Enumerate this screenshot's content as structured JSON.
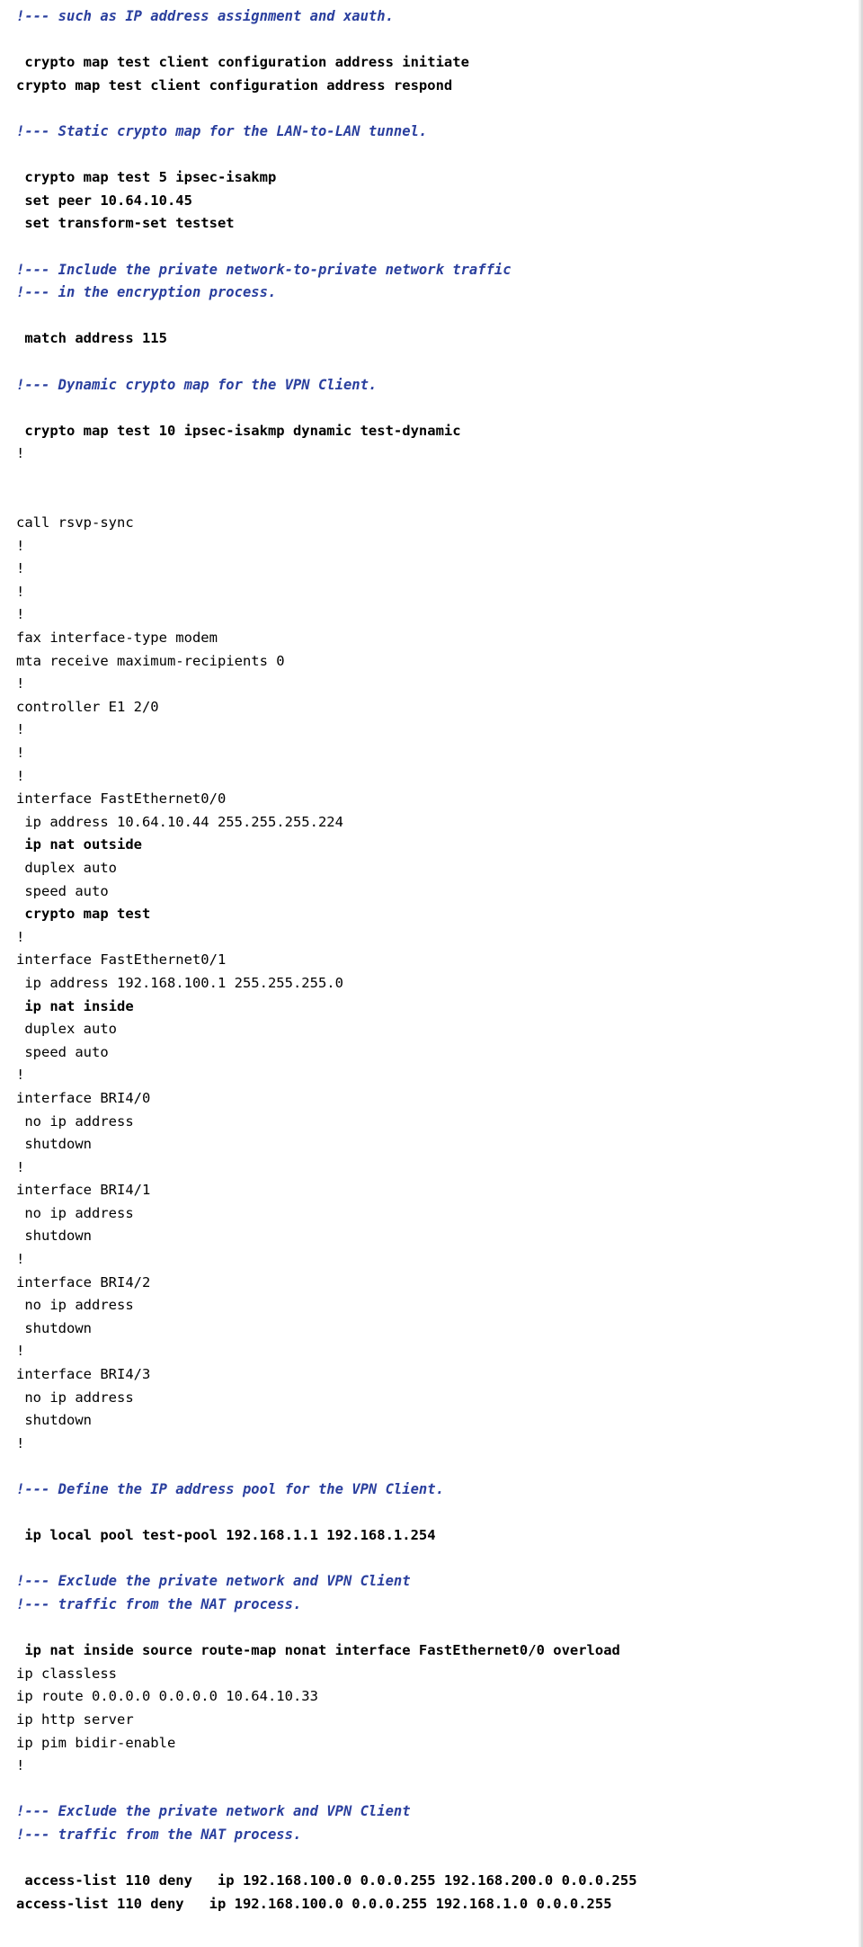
{
  "document": {
    "type": "cisco-router-configuration-listing",
    "lines": [
      {
        "text": "!--- such as IP address assignment and xauth.",
        "style": "comment"
      },
      {
        "text": "",
        "style": "blank"
      },
      {
        "text": " crypto map test client configuration address initiate",
        "style": "bold"
      },
      {
        "text": "crypto map test client configuration address respond",
        "style": "bold"
      },
      {
        "text": "",
        "style": "blank"
      },
      {
        "text": "!--- Static crypto map for the LAN-to-LAN tunnel.",
        "style": "comment"
      },
      {
        "text": "",
        "style": "blank"
      },
      {
        "text": " crypto map test 5 ipsec-isakmp",
        "style": "bold"
      },
      {
        "text": " set peer 10.64.10.45",
        "style": "bold"
      },
      {
        "text": " set transform-set testset",
        "style": "bold"
      },
      {
        "text": "",
        "style": "blank"
      },
      {
        "text": "!--- Include the private network-to-private network traffic",
        "style": "comment"
      },
      {
        "text": "!--- in the encryption process.",
        "style": "comment"
      },
      {
        "text": "",
        "style": "blank"
      },
      {
        "text": " match address 115",
        "style": "bold"
      },
      {
        "text": "",
        "style": "blank"
      },
      {
        "text": "!--- Dynamic crypto map for the VPN Client.",
        "style": "comment"
      },
      {
        "text": "",
        "style": "blank"
      },
      {
        "text": " crypto map test 10 ipsec-isakmp dynamic test-dynamic",
        "style": "bold"
      },
      {
        "text": "!",
        "style": "plain"
      },
      {
        "text": "",
        "style": "blank"
      },
      {
        "text": "",
        "style": "blank"
      },
      {
        "text": "call rsvp-sync",
        "style": "plain"
      },
      {
        "text": "!",
        "style": "plain"
      },
      {
        "text": "!",
        "style": "plain"
      },
      {
        "text": "!",
        "style": "plain"
      },
      {
        "text": "!",
        "style": "plain"
      },
      {
        "text": "fax interface-type modem",
        "style": "plain"
      },
      {
        "text": "mta receive maximum-recipients 0",
        "style": "plain"
      },
      {
        "text": "!",
        "style": "plain"
      },
      {
        "text": "controller E1 2/0",
        "style": "plain"
      },
      {
        "text": "!",
        "style": "plain"
      },
      {
        "text": "!",
        "style": "plain"
      },
      {
        "text": "!",
        "style": "plain"
      },
      {
        "text": "interface FastEthernet0/0",
        "style": "plain"
      },
      {
        "text": " ip address 10.64.10.44 255.255.255.224",
        "style": "plain"
      },
      {
        "text": " ip nat outside",
        "style": "bold"
      },
      {
        "text": " duplex auto",
        "style": "plain"
      },
      {
        "text": " speed auto",
        "style": "plain"
      },
      {
        "text": " crypto map test",
        "style": "bold"
      },
      {
        "text": "!",
        "style": "plain"
      },
      {
        "text": "interface FastEthernet0/1",
        "style": "plain"
      },
      {
        "text": " ip address 192.168.100.1 255.255.255.0",
        "style": "plain"
      },
      {
        "text": " ip nat inside",
        "style": "bold"
      },
      {
        "text": " duplex auto",
        "style": "plain"
      },
      {
        "text": " speed auto",
        "style": "plain"
      },
      {
        "text": "!",
        "style": "plain"
      },
      {
        "text": "interface BRI4/0",
        "style": "plain"
      },
      {
        "text": " no ip address",
        "style": "plain"
      },
      {
        "text": " shutdown",
        "style": "plain"
      },
      {
        "text": "!",
        "style": "plain"
      },
      {
        "text": "interface BRI4/1",
        "style": "plain"
      },
      {
        "text": " no ip address",
        "style": "plain"
      },
      {
        "text": " shutdown",
        "style": "plain"
      },
      {
        "text": "!",
        "style": "plain"
      },
      {
        "text": "interface BRI4/2",
        "style": "plain"
      },
      {
        "text": " no ip address",
        "style": "plain"
      },
      {
        "text": " shutdown",
        "style": "plain"
      },
      {
        "text": "!",
        "style": "plain"
      },
      {
        "text": "interface BRI4/3",
        "style": "plain"
      },
      {
        "text": " no ip address",
        "style": "plain"
      },
      {
        "text": " shutdown",
        "style": "plain"
      },
      {
        "text": "!",
        "style": "plain"
      },
      {
        "text": "",
        "style": "blank"
      },
      {
        "text": "!--- Define the IP address pool for the VPN Client.",
        "style": "comment"
      },
      {
        "text": "",
        "style": "blank"
      },
      {
        "text": " ip local pool test-pool 192.168.1.1 192.168.1.254",
        "style": "bold"
      },
      {
        "text": "",
        "style": "blank"
      },
      {
        "text": "!--- Exclude the private network and VPN Client",
        "style": "comment"
      },
      {
        "text": "!--- traffic from the NAT process.",
        "style": "comment"
      },
      {
        "text": "",
        "style": "blank"
      },
      {
        "text": " ip nat inside source route-map nonat interface FastEthernet0/0 overload",
        "style": "bold"
      },
      {
        "text": "ip classless",
        "style": "plain"
      },
      {
        "text": "ip route 0.0.0.0 0.0.0.0 10.64.10.33",
        "style": "plain"
      },
      {
        "text": "ip http server",
        "style": "plain"
      },
      {
        "text": "ip pim bidir-enable",
        "style": "plain"
      },
      {
        "text": "!",
        "style": "plain"
      },
      {
        "text": "",
        "style": "blank"
      },
      {
        "text": "!--- Exclude the private network and VPN Client",
        "style": "comment"
      },
      {
        "text": "!--- traffic from the NAT process.",
        "style": "comment"
      },
      {
        "text": "",
        "style": "blank"
      },
      {
        "text": " access-list 110 deny   ip 192.168.100.0 0.0.0.255 192.168.200.0 0.0.0.255",
        "style": "bold"
      },
      {
        "text": "access-list 110 deny   ip 192.168.100.0 0.0.0.255 192.168.1.0 0.0.0.255",
        "style": "bold"
      }
    ]
  }
}
